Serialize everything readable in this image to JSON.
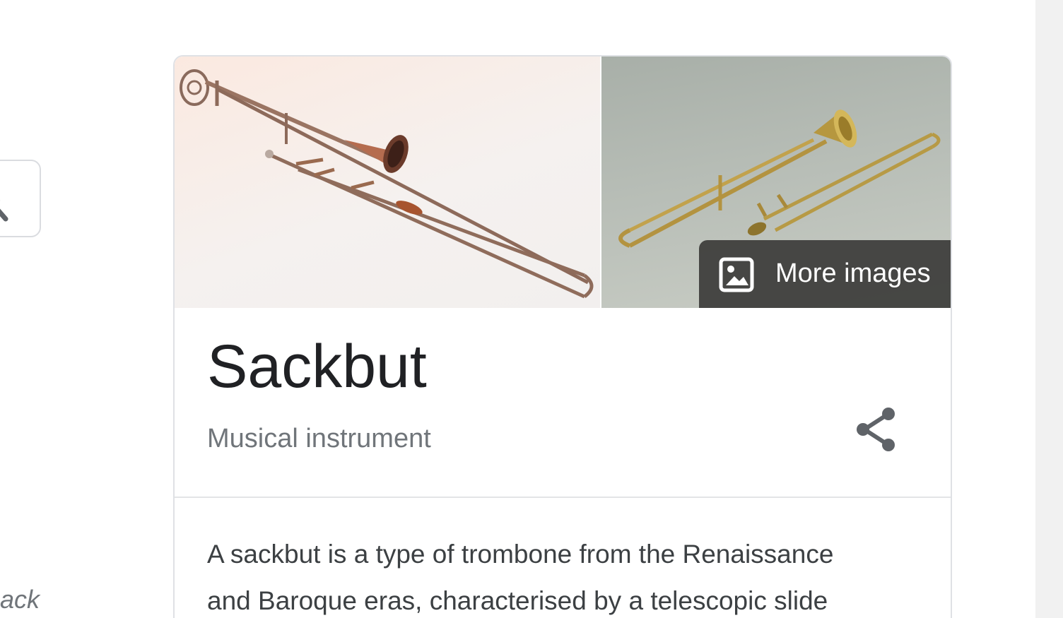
{
  "search": {
    "icon": "search-icon"
  },
  "left_partial_text": "ack",
  "knowledge_panel": {
    "images": [
      {
        "alt": "sackbut image 1",
        "icon": "sackbut-photo-1"
      },
      {
        "alt": "sackbut image 2",
        "icon": "sackbut-photo-2"
      }
    ],
    "more_images_label": "More images",
    "more_images_icon": "image-icon",
    "title": "Sackbut",
    "subtitle": "Musical instrument",
    "share_icon": "share-icon",
    "description_lines": [
      "A sackbut is a type of trombone from the Renaissance",
      "and Baroque eras, characterised by a telescopic slide"
    ]
  },
  "colors": {
    "title": "#202124",
    "subtitle": "#70757a",
    "border": "#dfe1e5",
    "overlay": "#3c3c3a",
    "share_icon": "#5f6368"
  }
}
